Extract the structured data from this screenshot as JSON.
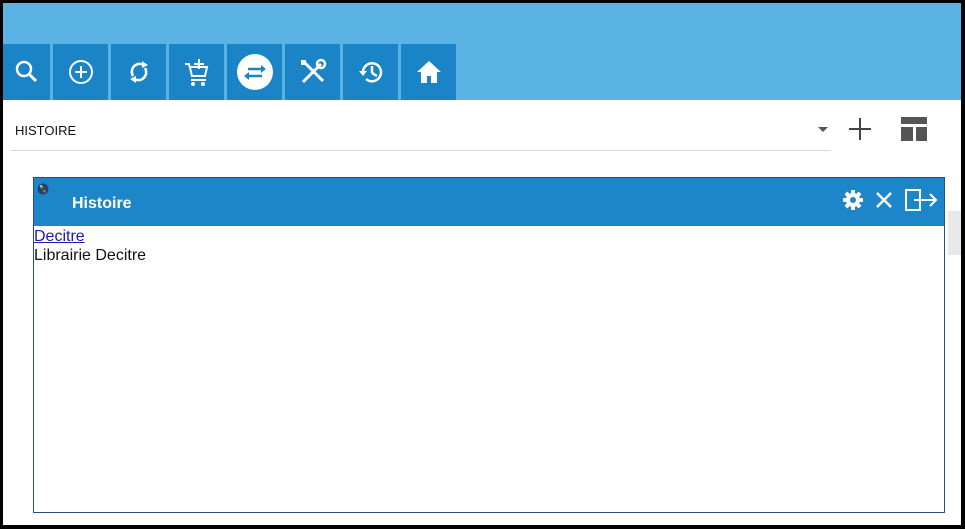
{
  "toolbar": {
    "buttons": [
      {
        "icon": "search-icon"
      },
      {
        "icon": "add-circle-icon"
      },
      {
        "icon": "refresh-icon"
      },
      {
        "icon": "cart-add-icon"
      },
      {
        "icon": "swap-icon"
      },
      {
        "icon": "tools-icon"
      },
      {
        "icon": "history-icon"
      },
      {
        "icon": "home-icon"
      }
    ]
  },
  "selector": {
    "value": "HISTOIRE"
  },
  "panel": {
    "title": "Histoire",
    "link_text": "Decitre",
    "description": "Librairie Decitre"
  },
  "colors": {
    "topbar": "#5ab3e4",
    "button": "#1a84c7",
    "panel_header": "#1d86c9"
  }
}
